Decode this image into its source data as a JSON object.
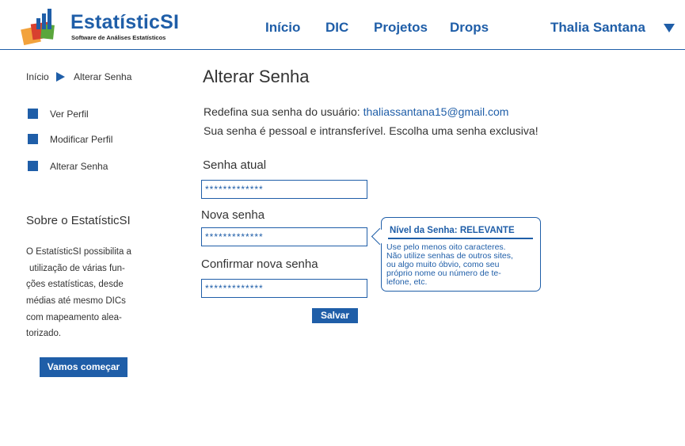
{
  "colors": {
    "accent": "#1f5ea8",
    "orange": "#f2a23c",
    "red": "#d8402f",
    "green": "#5aa63c"
  },
  "brand": {
    "name": "EstatísticSI",
    "tagline": "Software de Análises Estatísticos"
  },
  "nav": {
    "items": [
      "Início",
      "DIC",
      "Projetos",
      "Drops"
    ]
  },
  "user": {
    "name": "Thalia Santana",
    "menu_icon": "chevron-down-icon"
  },
  "breadcrumb": {
    "home": "Início",
    "current": "Alterar Senha"
  },
  "sidebar": {
    "items": [
      "Ver Perfil",
      "Modificar Perfil",
      "Alterar Senha"
    ]
  },
  "about": {
    "title": "Sobre o EstatísticSI",
    "lines": [
      "O EstatísticSI possibilita a",
      "utilização de várias fun-",
      "ções estatísticas, desde",
      "médias até mesmo DICs",
      "com mapeamento alea-",
      "torizado."
    ],
    "button": "Vamos começar"
  },
  "main": {
    "title": "Alterar Senha",
    "intro_prefix": "Redefina sua senha do usuário:",
    "email": "thaliassantana15@gmail.com",
    "intro2": "Sua senha é pessoal e intransferível. Escolha uma senha exclusiva!",
    "fields": {
      "current": {
        "label": "Senha atual",
        "value": "*************"
      },
      "new": {
        "label": "Nova senha",
        "value": "*************"
      },
      "confirm": {
        "label": "Confirmar nova senha",
        "value": "*************"
      }
    },
    "save": "Salvar"
  },
  "tooltip": {
    "heading": "Nível da Senha:  RELEVANTE",
    "lines": [
      "Use pelo menos oito caracteres.",
      "Não utilize senhas de outros sites,",
      "ou algo  muito óbvio, como seu",
      "próprio nome ou número de te-",
      "lefone, etc."
    ]
  }
}
